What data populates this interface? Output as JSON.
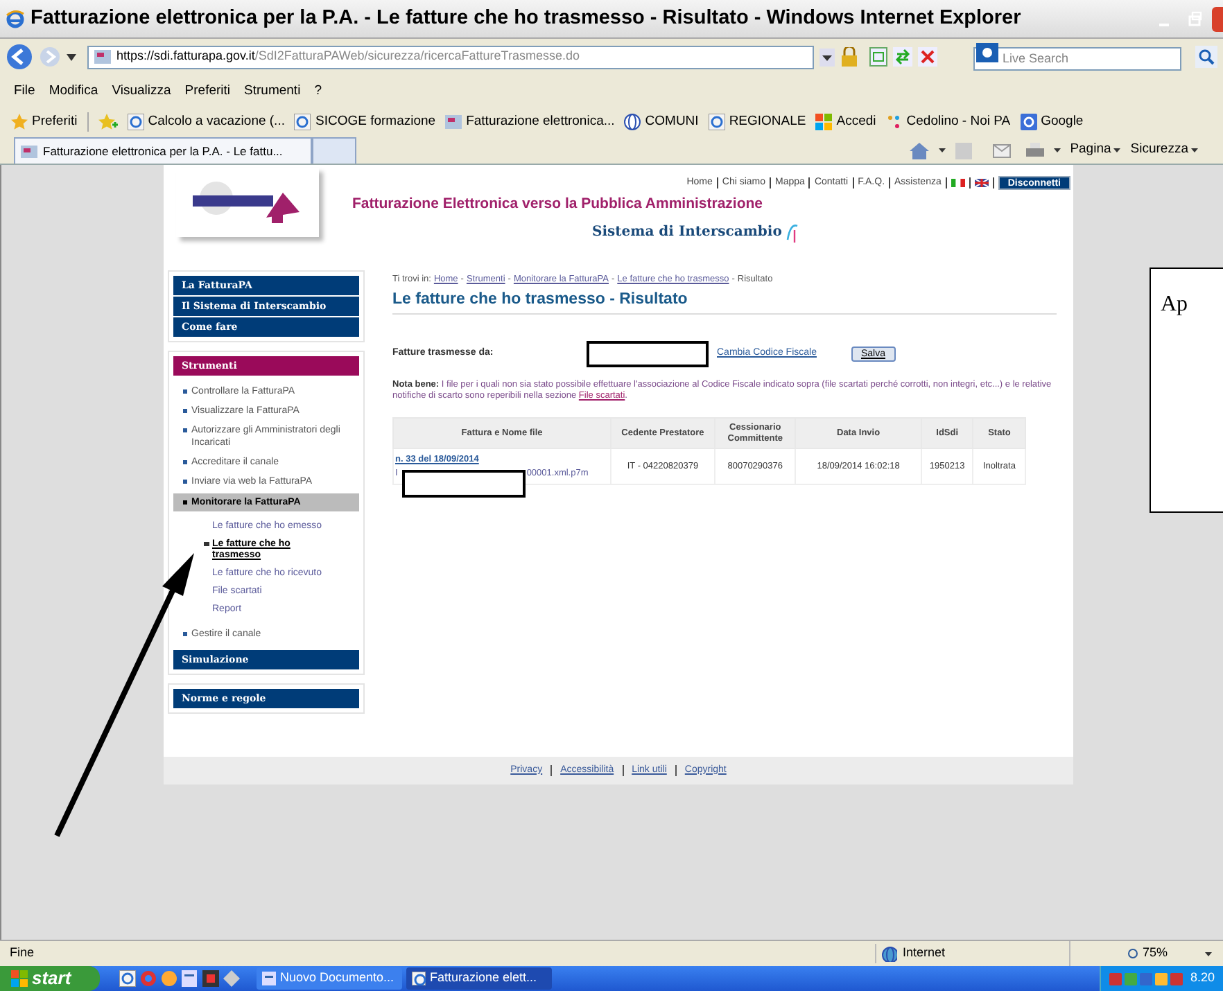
{
  "window": {
    "title": "Fatturazione elettronica per la P.A. - Le fatture che ho trasmesso - Risultato - Windows Internet Explorer"
  },
  "address": {
    "host": "https://sdi.fatturapa.gov.it",
    "path": "/SdI2FatturaPAWeb/sicurezza/ricercaFattureTrasmesse.do"
  },
  "search": {
    "placeholder": "Live Search"
  },
  "menu": [
    "File",
    "Modifica",
    "Visualizza",
    "Preferiti",
    "Strumenti",
    "?"
  ],
  "favorites": [
    "Preferiti",
    "Calcolo a vacazione (...",
    "SICOGE formazione",
    "Fatturazione elettronica...",
    "COMUNI",
    "REGIONALE",
    "Accedi",
    "Cedolino - Noi PA",
    "Google"
  ],
  "tabs": [
    {
      "label": "Fatturazione elettronica per la P.A. - Le fattu...",
      "selected": true
    },
    {
      "selected": false
    }
  ],
  "commands": [
    "Pagina",
    "Sicurezza"
  ],
  "site": {
    "top_links": [
      "Home",
      "Chi siamo",
      "Mappa",
      "Contatti",
      "F.A.Q.",
      "Assistenza"
    ],
    "logout": "Disconnetti",
    "title": "Fatturazione Elettronica verso la Pubblica Amministrazione",
    "subtitle": "Sistema di Interscambio"
  },
  "sidebar": [
    [
      {
        "kind": "header",
        "label": "La FatturaPA",
        "highlighted": false
      },
      {
        "kind": "header",
        "label": "Il Sistema di Interscambio",
        "highlighted": false
      },
      {
        "kind": "header",
        "label": "Come fare",
        "highlighted": false
      }
    ],
    [
      {
        "kind": "header",
        "label": "Strumenti",
        "highlighted": true
      },
      {
        "kind": "link",
        "label": "Controllare la FatturaPA",
        "expanded": false
      },
      {
        "kind": "link",
        "label": "Visualizzare la FatturaPA",
        "expanded": false
      },
      {
        "kind": "link",
        "label": "Autorizzare gli Amministratori degli Incaricati",
        "expanded": false
      },
      {
        "kind": "link",
        "label": "Accreditare il canale",
        "expanded": false
      },
      {
        "kind": "link",
        "label": "Inviare via web la FatturaPA",
        "expanded": false
      },
      {
        "kind": "link",
        "label": "Monitorare la FatturaPA",
        "expanded": true,
        "children": [
          {
            "label": "Le fatture che ho emesso",
            "selected": false
          },
          {
            "label": "Le fatture che ho trasmesso",
            "selected": true
          },
          {
            "label": "Le fatture che ho ricevuto",
            "selected": false
          },
          {
            "label": "File scartati",
            "selected": false
          },
          {
            "label": "Report",
            "selected": false
          }
        ]
      },
      {
        "kind": "link",
        "label": "Gestire il canale",
        "expanded": false
      },
      {
        "kind": "header",
        "label": "Simulazione",
        "highlighted": false
      }
    ],
    [
      {
        "kind": "header",
        "label": "Norme e regole",
        "highlighted": false
      }
    ]
  ],
  "breadcrumb": [
    {
      "kind": "label",
      "text": "Ti trovi in:"
    },
    {
      "kind": "link",
      "text": "Home"
    },
    {
      "kind": "separator",
      "text": "-"
    },
    {
      "kind": "link",
      "text": "Strumenti"
    },
    {
      "kind": "separator",
      "text": "-"
    },
    {
      "kind": "link",
      "text": "Monitorare la FatturaPA"
    },
    {
      "kind": "separator",
      "text": "-"
    },
    {
      "kind": "link",
      "text": "Le fatture che ho trasmesso"
    },
    {
      "kind": "separator",
      "text": "-"
    },
    {
      "kind": "label",
      "text": "Risultato"
    }
  ],
  "heading": "Le fatture che ho trasmesso - Risultato",
  "form": {
    "label": "Fatture trasmesse da:",
    "link": "Cambia Codice Fiscale",
    "button": "Salva"
  },
  "note": {
    "label": "Nota bene:",
    "text": "I file per i quali non sia stato possibile effettuare l'associazione al Codice Fiscale indicato sopra (file scartati perché corrotti, non integri, etc...) e le relative notifiche di scarto sono reperibili nella sezione",
    "link": "File scartati",
    "end": "."
  },
  "table": {
    "columns": [
      "Fattura e Nome file",
      "Cedente Prestatore",
      "Cessionario Committente",
      "Data Invio",
      "IdSdi",
      "Stato"
    ],
    "rows": [
      {
        "cells": [
          {
            "link": "n. 33 del 18/09/2014",
            "file_start": "I",
            "file_end": "00001.xml.p7m"
          },
          {
            "text": "IT - 04220820379"
          },
          {
            "text": "80070290376"
          },
          {
            "text": "18/09/2014 16:02:18"
          },
          {
            "text": "1950213"
          },
          {
            "text": "Inoltrata"
          }
        ]
      }
    ]
  },
  "footer": [
    "Privacy",
    "Accessibilità",
    "Link utili",
    "Copyright"
  ],
  "side_document": {
    "text": "Ap"
  },
  "status_bar": {
    "text": "Fine",
    "zone": "Internet",
    "zoom": "75%"
  },
  "taskbar": {
    "start": "start",
    "tasks": [
      {
        "label": "Nuovo Documento...",
        "selected": false
      },
      {
        "label": "Fatturazione elett...",
        "selected": true
      }
    ],
    "clock": "8.20"
  }
}
